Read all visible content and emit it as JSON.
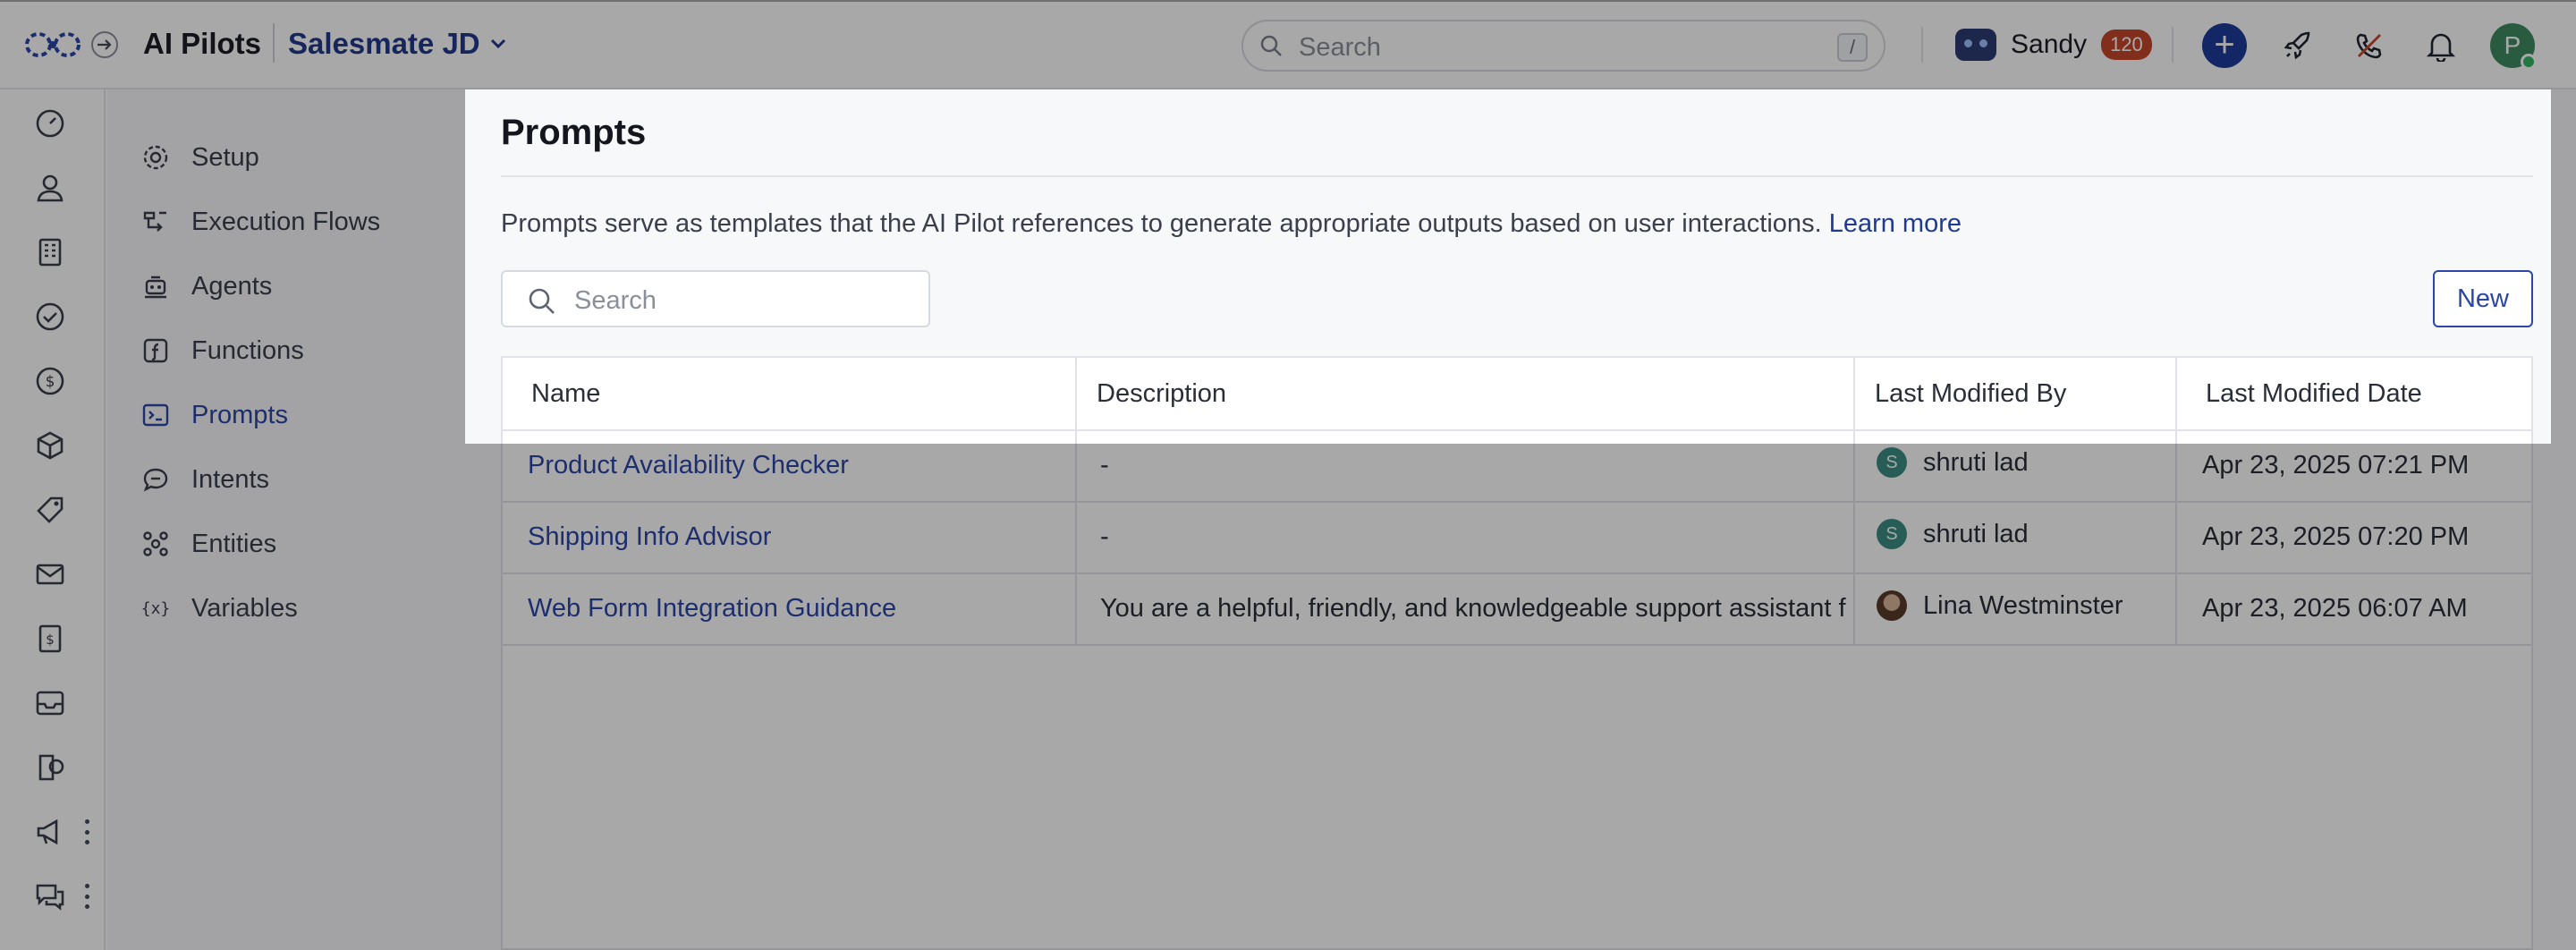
{
  "header": {
    "app_title": "AI Pilots",
    "workspace": "Salesmate JD",
    "search_placeholder": "Search",
    "search_shortcut": "/",
    "user_name": "Sandy",
    "user_count": "120",
    "avatar_initial": "P",
    "accent_color": "#1e3a9b"
  },
  "rail": {
    "icons": [
      "dashboard-icon",
      "contacts-icon",
      "companies-icon",
      "tasks-icon",
      "deals-icon",
      "products-icon",
      "tags-icon",
      "email-icon",
      "invoices-icon",
      "inbox-icon",
      "ai-pilot-icon",
      "campaigns-icon",
      "conversations-icon"
    ]
  },
  "subnav": {
    "items": [
      {
        "label": "Setup",
        "icon": "gear-icon"
      },
      {
        "label": "Execution Flows",
        "icon": "flow-icon"
      },
      {
        "label": "Agents",
        "icon": "agent-icon"
      },
      {
        "label": "Functions",
        "icon": "function-icon"
      },
      {
        "label": "Prompts",
        "icon": "terminal-icon",
        "active": true
      },
      {
        "label": "Intents",
        "icon": "chat-bubble-icon"
      },
      {
        "label": "Entities",
        "icon": "entities-icon"
      },
      {
        "label": "Variables",
        "icon": "variable-icon"
      }
    ]
  },
  "page": {
    "title": "Prompts",
    "description": "Prompts serve as templates that the AI Pilot references to generate appropriate outputs based on user interactions.",
    "learn_more": "Learn more",
    "search_placeholder": "Search",
    "new_label": "New"
  },
  "table": {
    "columns": [
      "Name",
      "Description",
      "Last Modified By",
      "Last Modified Date"
    ],
    "rows": [
      {
        "name": "Product Availability Checker",
        "description": "-",
        "modified_by": "shruti lad",
        "initial": "S",
        "date": "Apr 23, 2025 07:21 PM"
      },
      {
        "name": "Shipping Info Advisor",
        "description": "-",
        "modified_by": "shruti lad",
        "initial": "S",
        "date": "Apr 23, 2025 07:20 PM"
      },
      {
        "name": "Web Form Integration Guidance",
        "description": "You are a helpful, friendly, and knowledgeable support assistant f",
        "modified_by": "Lina Westminster",
        "initial": "",
        "date": "Apr 23, 2025 06:07 AM"
      }
    ]
  }
}
